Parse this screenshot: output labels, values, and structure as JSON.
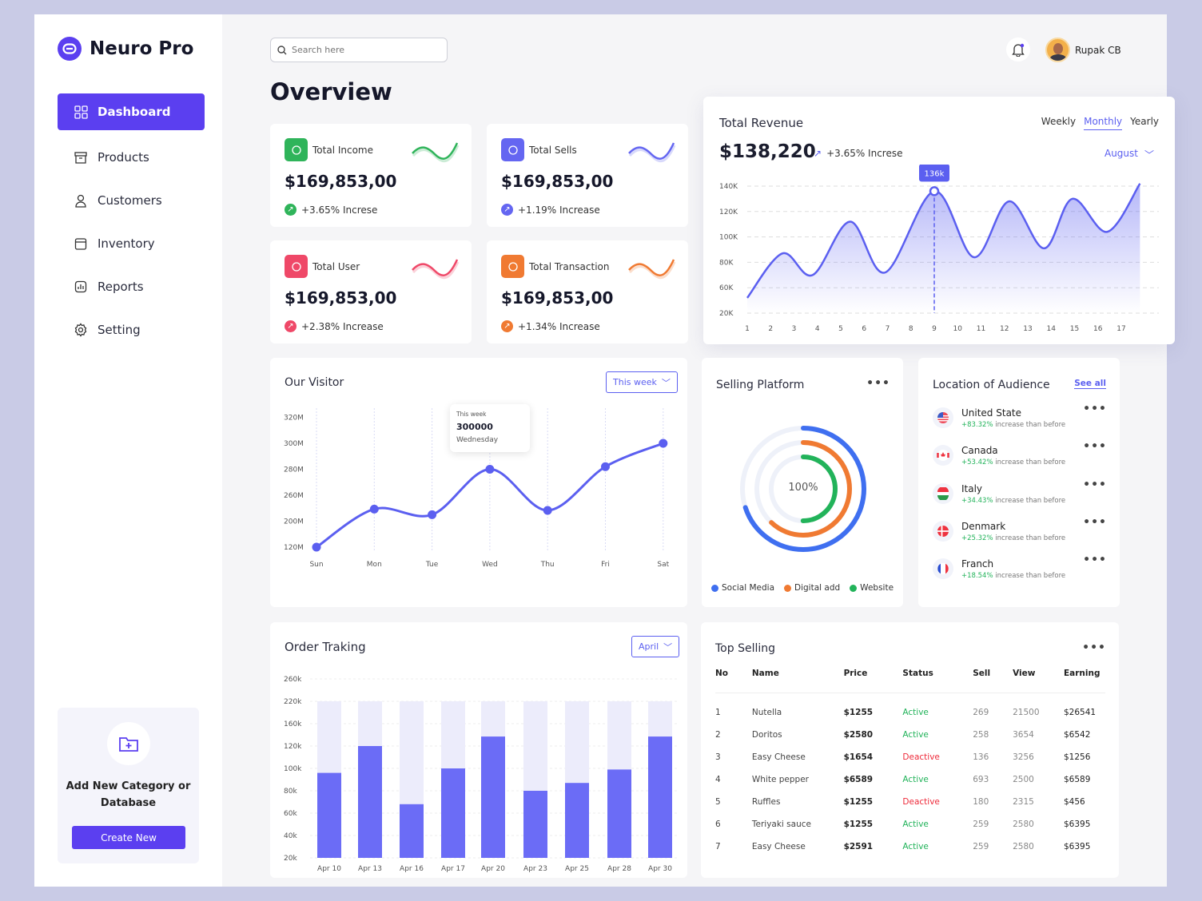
{
  "brand": {
    "name": "Neuro Pro",
    "accent": "#5b3ff0"
  },
  "sidebar": {
    "items": [
      {
        "label": "Dashboard",
        "icon": "grid-icon",
        "active": true
      },
      {
        "label": "Products",
        "icon": "archive-icon"
      },
      {
        "label": "Customers",
        "icon": "user-icon"
      },
      {
        "label": "Inventory",
        "icon": "box-icon"
      },
      {
        "label": "Reports",
        "icon": "bar-chart-icon"
      },
      {
        "label": "Setting",
        "icon": "gear-icon"
      }
    ],
    "promo": {
      "title": "Add New Category or Database",
      "button": "Create New",
      "icon": "folder-plus-icon"
    }
  },
  "header": {
    "search_placeholder": "Search here",
    "user": "Rupak CB",
    "title": "Overview"
  },
  "stats": [
    {
      "label": "Total Income",
      "value": "$169,853,00",
      "change": "+3.65% Increse",
      "color": "#2fb45a",
      "icon": "money-hand-icon"
    },
    {
      "label": "Total Sells",
      "value": "$169,853,00",
      "change": "+1.19% Increase",
      "color": "#6466f1",
      "icon": "growth-chart-icon"
    },
    {
      "label": "Total User",
      "value": "$169,853,00",
      "change": "+2.38% Increase",
      "color": "#ef4868",
      "icon": "users-icon"
    },
    {
      "label": "Total Transaction",
      "value": "$169,853,00",
      "change": "+1.34% Increase",
      "color": "#f07a32",
      "icon": "exchange-icon"
    }
  ],
  "revenue": {
    "title": "Total Revenue",
    "value": "$138,220",
    "change": "+3.65% Increse",
    "tabs": [
      "Weekly",
      "Monthly",
      "Yearly"
    ],
    "active_tab": "Monthly",
    "month": "August"
  },
  "visitor": {
    "title": "Our Visitor",
    "filter": "This week",
    "tooltip": {
      "label": "This week",
      "value": "300000",
      "day": "Wednesday"
    }
  },
  "platform": {
    "title": "Selling Platform",
    "center": "100%"
  },
  "location": {
    "title": "Location of Audience",
    "see_all": "See all",
    "suffix": "increase than before",
    "items": [
      {
        "country": "United State",
        "change": "+83.32%",
        "flag": "us-flag-icon"
      },
      {
        "country": "Canada",
        "change": "+53.42%",
        "flag": "ca-flag-icon"
      },
      {
        "country": "Italy",
        "change": "+34.43%",
        "flag": "it-flag-icon"
      },
      {
        "country": "Denmark",
        "change": "+25.32%",
        "flag": "dk-flag-icon"
      },
      {
        "country": "Franch",
        "change": "+18.54%",
        "flag": "fr-flag-icon"
      }
    ]
  },
  "orders": {
    "title": "Order Traking",
    "filter": "April"
  },
  "top_selling": {
    "title": "Top Selling",
    "columns": [
      "No",
      "Name",
      "Price",
      "Status",
      "Sell",
      "View",
      "Earning"
    ],
    "rows": [
      [
        "1",
        "Nutella",
        "$1255",
        "Active",
        "269",
        "21500",
        "$26541"
      ],
      [
        "2",
        "Doritos",
        "$2580",
        "Active",
        "258",
        "3654",
        "$6542"
      ],
      [
        "3",
        "Easy Cheese",
        "$1654",
        "Deactive",
        "136",
        "3256",
        "$1256"
      ],
      [
        "4",
        "White pepper",
        "$6589",
        "Active",
        "693",
        "2500",
        "$6589"
      ],
      [
        "5",
        "Ruffles",
        "$1255",
        "Deactive",
        "180",
        "2315",
        "$456"
      ],
      [
        "6",
        "Teriyaki sauce",
        "$1255",
        "Active",
        "259",
        "2580",
        "$6395"
      ],
      [
        "7",
        "Easy Cheese",
        "$2591",
        "Active",
        "259",
        "2580",
        "$6395"
      ]
    ]
  },
  "chart_data": [
    {
      "type": "area",
      "name": "revenue",
      "x_ticks": [
        "1",
        "2",
        "3",
        "4",
        "5",
        "6",
        "7",
        "8",
        "9",
        "10",
        "11",
        "12",
        "13",
        "14",
        "15",
        "16",
        "17"
      ],
      "y_ticks": [
        "20K",
        "60K",
        "80K",
        "100K",
        "120K",
        "140K"
      ],
      "y_tick_values": [
        20,
        60,
        80,
        100,
        120,
        140
      ],
      "points": [
        [
          1,
          44
        ],
        [
          2.5,
          87
        ],
        [
          3.8,
          70
        ],
        [
          5.4,
          112
        ],
        [
          6.9,
          72
        ],
        [
          9,
          136
        ],
        [
          10.7,
          84
        ],
        [
          12.2,
          128
        ],
        [
          13.7,
          91
        ],
        [
          14.9,
          130
        ],
        [
          16.4,
          104
        ],
        [
          17.8,
          142
        ]
      ],
      "highlight": {
        "x": 9,
        "label": "136k"
      },
      "grid": true,
      "color": "#5b5ff0"
    },
    {
      "type": "line",
      "name": "visitor",
      "categories": [
        "Sun",
        "Mon",
        "Tue",
        "Wed",
        "Thu",
        "Fri",
        "Sat"
      ],
      "y_ticks": [
        "120M",
        "200M",
        "260M",
        "280M",
        "300M",
        "320M"
      ],
      "y_tick_values": [
        120,
        200,
        260,
        280,
        300,
        320
      ],
      "values": [
        120,
        228,
        215,
        280,
        225,
        282,
        300
      ],
      "grid": true,
      "color": "#5b5ff0"
    },
    {
      "type": "bar",
      "name": "orders",
      "categories": [
        "Apr 10",
        "Apr 13",
        "Apr 16",
        "Apr 17",
        "Apr 20",
        "Apr 23",
        "Apr 25",
        "Apr 28",
        "Apr 30"
      ],
      "y_ticks": [
        "20k",
        "40k",
        "60k",
        "80k",
        "100k",
        "120k",
        "160k",
        "220k",
        "260k"
      ],
      "y_tick_values": [
        20,
        40,
        60,
        80,
        100,
        120,
        160,
        220,
        260
      ],
      "values": [
        96,
        120,
        68,
        100,
        137,
        80,
        87,
        99,
        137
      ],
      "max": 220,
      "color": "#6b6cf6",
      "track": "#ececfb"
    },
    {
      "type": "pie",
      "name": "platform",
      "series": [
        {
          "name": "Social Media",
          "value": 70,
          "color": "#3f6ff0"
        },
        {
          "name": "Digital add",
          "value": 62,
          "color": "#f07a32"
        },
        {
          "name": "Website",
          "value": 50,
          "color": "#22b35a"
        }
      ]
    }
  ]
}
